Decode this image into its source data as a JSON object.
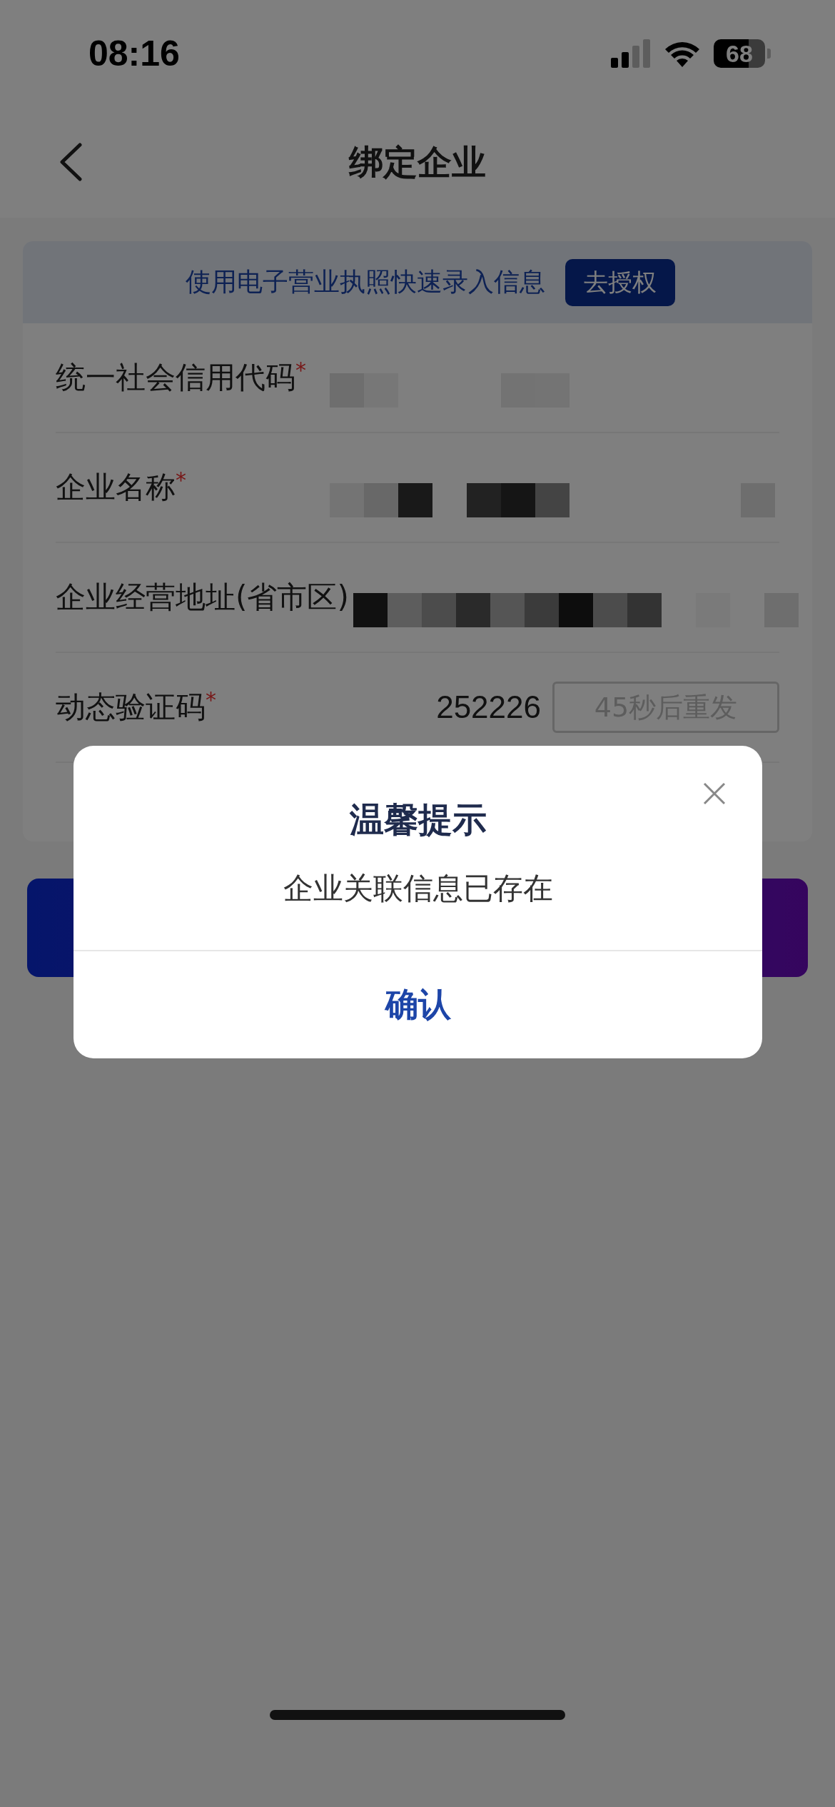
{
  "status_bar": {
    "time": "08:16",
    "battery": "68"
  },
  "nav": {
    "title": "绑定企业"
  },
  "banner": {
    "text": "使用电子营业执照快速录入信息",
    "button": "去授权"
  },
  "fields": [
    {
      "kind": "redacted",
      "label": "统一社会信用代码",
      "mark": "*"
    },
    {
      "kind": "redacted",
      "label": "企业名称",
      "mark": "*"
    },
    {
      "kind": "redacted",
      "label": "企业经营地址(省市区)"
    },
    {
      "kind": "code",
      "label": "动态验证码",
      "mark": "*",
      "value": "252226",
      "resend": "45秒后重发",
      "resend_disabled": true
    }
  ],
  "dialog": {
    "title": "温馨提示",
    "message": "企业关联信息已存在",
    "confirm": "确认"
  }
}
